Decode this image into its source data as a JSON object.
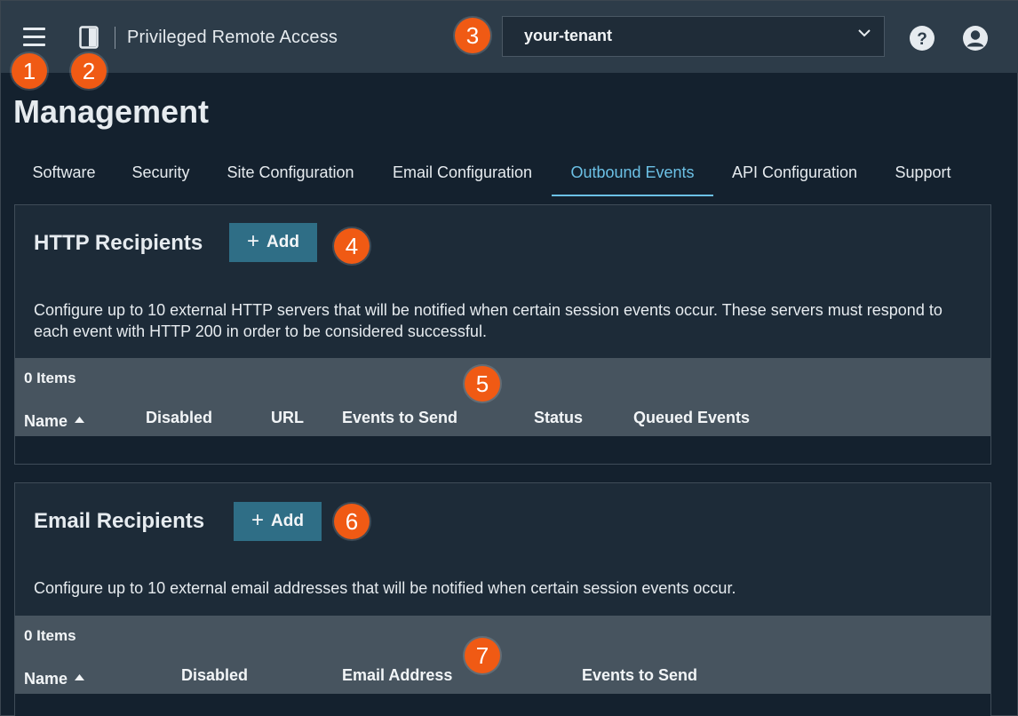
{
  "header": {
    "app_title": "Privileged Remote Access",
    "tenant": {
      "value": "your-tenant"
    },
    "icons": [
      "menu-icon",
      "panel-icon",
      "chevron-down-icon",
      "help-icon",
      "user-icon"
    ]
  },
  "callouts": [
    "1",
    "2",
    "3",
    "4",
    "5",
    "6",
    "7"
  ],
  "page": {
    "title": "Management",
    "tabs": [
      {
        "label": "Software"
      },
      {
        "label": "Security"
      },
      {
        "label": "Site Configuration"
      },
      {
        "label": "Email Configuration"
      },
      {
        "label": "Outbound Events",
        "active": true
      },
      {
        "label": "API Configuration"
      },
      {
        "label": "Support"
      }
    ]
  },
  "http_recipients": {
    "title": "HTTP Recipients",
    "add_label": "Add",
    "description": "Configure up to 10 external HTTP servers that will be notified when certain session events occur. These servers must respond to each event with HTTP 200 in order to be considered successful.",
    "count": "0 Items",
    "columns": [
      "Name",
      "Disabled",
      "URL",
      "Events to Send",
      "Status",
      "Queued Events"
    ]
  },
  "email_recipients": {
    "title": "Email Recipients",
    "add_label": "Add",
    "description": "Configure up to 10 external email addresses that will be notified when certain session events occur.",
    "count": "0 Items",
    "columns": [
      "Name",
      "Disabled",
      "Email Address",
      "Events to Send"
    ]
  },
  "colors": {
    "background": "#14212e",
    "topbar": "#2d3c49",
    "accent": "#6cc1e6",
    "button": "#2f6e86",
    "callout": "#f05a14"
  }
}
